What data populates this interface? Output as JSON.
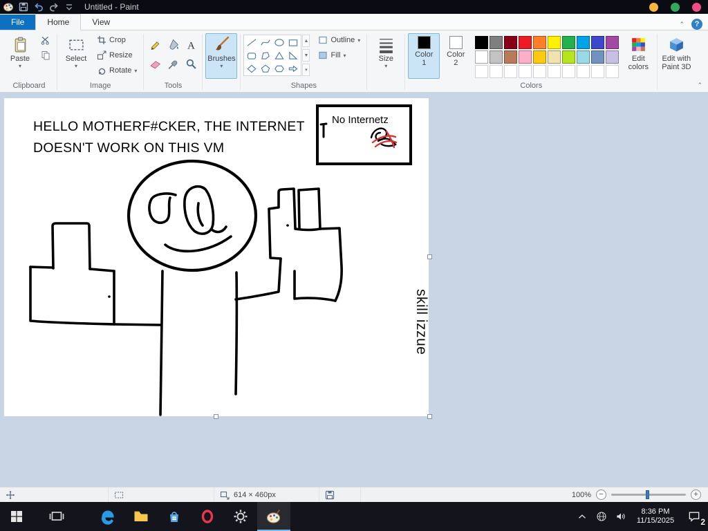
{
  "titlebar": {
    "title": "Untitled - Paint"
  },
  "tabs": {
    "file": "File",
    "home": "Home",
    "view": "View"
  },
  "ribbon": {
    "clipboard": {
      "label": "Clipboard",
      "paste": "Paste"
    },
    "image": {
      "label": "Image",
      "select": "Select",
      "crop": "Crop",
      "resize": "Resize",
      "rotate": "Rotate"
    },
    "tools": {
      "label": "Tools",
      "items": [
        "pencil",
        "fill",
        "text",
        "eraser",
        "color-picker",
        "magnifier"
      ]
    },
    "brushes": {
      "label": "Brushes"
    },
    "shapes": {
      "label": "Shapes",
      "outline": "Outline",
      "fill": "Fill",
      "items": [
        "line",
        "curve",
        "oval",
        "rectangle",
        "rounded-rectangle",
        "polygon",
        "triangle",
        "right-triangle",
        "diamond",
        "pentagon",
        "hexagon",
        "right-arrow"
      ]
    },
    "size": {
      "label": "Size"
    },
    "colors": {
      "label": "Colors",
      "color1": {
        "line1": "Color",
        "line2": "1",
        "value": "#000000"
      },
      "color2": {
        "line1": "Color",
        "line2": "2",
        "value": "#ffffff"
      },
      "edit_colors": {
        "line1": "Edit",
        "line2": "colors"
      },
      "palette": [
        [
          "#000000",
          "#7f7f7f",
          "#880015",
          "#ed1c24",
          "#ff7f27",
          "#fff200",
          "#22b14c",
          "#00a2e8",
          "#3f48cc",
          "#a349a4"
        ],
        [
          "#ffffff",
          "#c3c3c3",
          "#b97a57",
          "#ffaec9",
          "#ffc90e",
          "#efe4b0",
          "#b5e61d",
          "#99d9ea",
          "#7092be",
          "#c8bfe7"
        ]
      ],
      "empty_slots": 10
    },
    "paint3d": {
      "line1": "Edit with",
      "line2": "Paint 3D"
    }
  },
  "canvas": {
    "message_line1": "HELLO MOTHERF#CKER, THE INTERNET",
    "message_line2": "DOESN'T WORK ON THIS VM",
    "sign": {
      "text": "No Internetz"
    },
    "vertical_text": "skill izzue",
    "ink_color": "#000000",
    "scribble_red": "#d23535"
  },
  "statusbar": {
    "dimensions": "614 × 460px",
    "zoom": "100%"
  },
  "taskbar": {
    "time": "8:36 PM",
    "date": "11/15/2025",
    "notification_count": "2"
  },
  "theme": {
    "file_tab_blue": "#0e70c1",
    "selection_blue": "#cbe4f6",
    "workspace_bg": "#c7d5e4",
    "titlebar_bg": "#0b0b13",
    "taskbar_bg": "#14141c"
  }
}
